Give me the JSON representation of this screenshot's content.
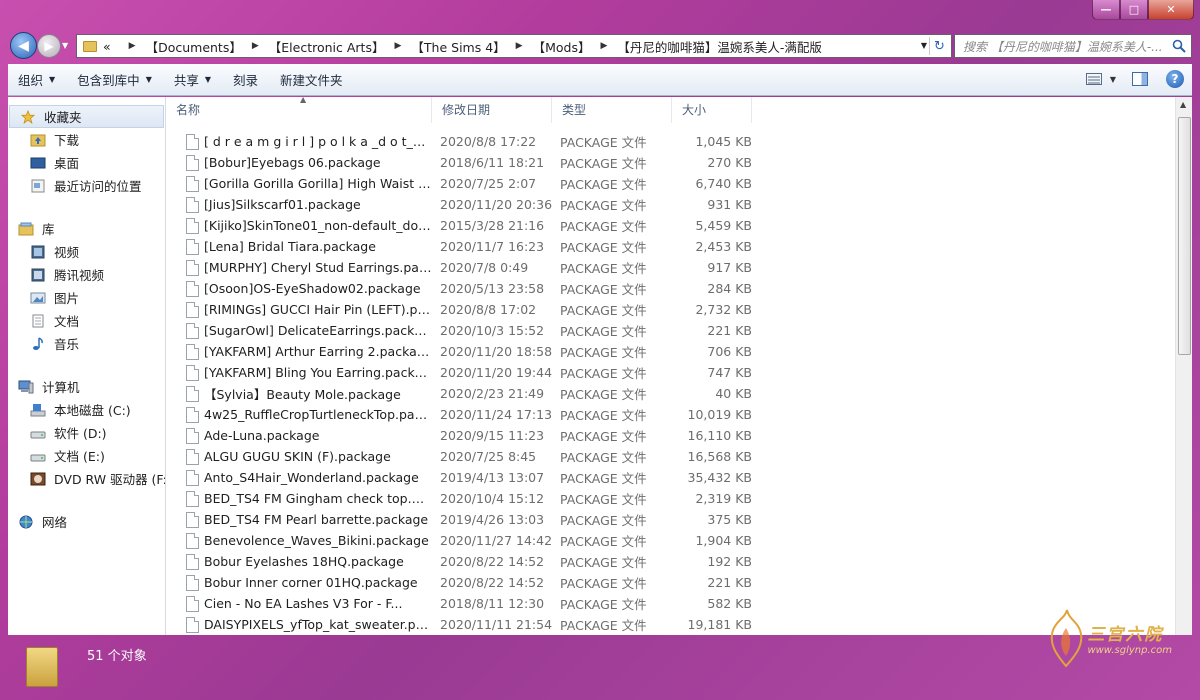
{
  "window": {
    "min_glyph": "—",
    "max_glyph": "□",
    "close_glyph": "✕"
  },
  "address": {
    "back_glyph": "◀",
    "forward_glyph": "▶",
    "overflow": "«",
    "crumbs": [
      "【Documents】",
      "【Electronic Arts】",
      "【The Sims 4】",
      "【Mods】",
      "【丹尼的咖啡猫】温婉系美人-满配版"
    ],
    "separator": "▶",
    "refresh_glyph": "↻"
  },
  "search": {
    "placeholder": "搜索 【丹尼的咖啡猫】温婉系美人-..."
  },
  "toolbar": {
    "organize": "组织",
    "include": "包含到库中",
    "share": "共享",
    "burn": "刻录",
    "new_folder": "新建文件夹",
    "arrow": "▼",
    "help": "?"
  },
  "nav": {
    "favorites": {
      "label": "收藏夹",
      "items": [
        "下载",
        "桌面",
        "最近访问的位置"
      ]
    },
    "libraries": {
      "label": "库",
      "items": [
        "视频",
        "腾讯视频",
        "图片",
        "文档",
        "音乐"
      ]
    },
    "computer": {
      "label": "计算机",
      "items": [
        "本地磁盘 (C:)",
        "软件 (D:)",
        "文档 (E:)",
        "DVD RW 驱动器 (F:"
      ]
    },
    "network": {
      "label": "网络"
    }
  },
  "columns": {
    "name": "名称",
    "date": "修改日期",
    "type": "类型",
    "size": "大小"
  },
  "files": [
    {
      "name": "[ d r e a m g i r l ] p o l k a _d o t_p e...",
      "date": "2020/8/8 17:22",
      "type": "PACKAGE 文件",
      "size": "1,045 KB"
    },
    {
      "name": "[Bobur]Eyebags 06.package",
      "date": "2018/6/11 18:21",
      "type": "PACKAGE 文件",
      "size": "270 KB"
    },
    {
      "name": "[Gorilla Gorilla Gorilla] High Waist Fri...",
      "date": "2020/7/25 2:07",
      "type": "PACKAGE 文件",
      "size": "6,740 KB"
    },
    {
      "name": "[Jius]Silkscarf01.package",
      "date": "2020/11/20 20:36",
      "type": "PACKAGE 文件",
      "size": "931 KB"
    },
    {
      "name": "[Kijiko]SkinTone01_non-default_dolly....",
      "date": "2015/3/28 21:16",
      "type": "PACKAGE 文件",
      "size": "5,459 KB"
    },
    {
      "name": "[Lena] Bridal Tiara.package",
      "date": "2020/11/7 16:23",
      "type": "PACKAGE 文件",
      "size": "2,453 KB"
    },
    {
      "name": "[MURPHY] Cheryl Stud Earrings.pack...",
      "date": "2020/7/8 0:49",
      "type": "PACKAGE 文件",
      "size": "917 KB"
    },
    {
      "name": "[Osoon]OS-EyeShadow02.package",
      "date": "2020/5/13 23:58",
      "type": "PACKAGE 文件",
      "size": "284 KB"
    },
    {
      "name": "[RIMINGs] GUCCI Hair Pin (LEFT).pac...",
      "date": "2020/8/8 17:02",
      "type": "PACKAGE 文件",
      "size": "2,732 KB"
    },
    {
      "name": "[SugarOwl] DelicateEarrings.package",
      "date": "2020/10/3 15:52",
      "type": "PACKAGE 文件",
      "size": "221 KB"
    },
    {
      "name": "[YAKFARM] Arthur Earring 2.package",
      "date": "2020/11/20 18:58",
      "type": "PACKAGE 文件",
      "size": "706 KB"
    },
    {
      "name": "[YAKFARM] Bling You Earring.package",
      "date": "2020/11/20 19:44",
      "type": "PACKAGE 文件",
      "size": "747 KB"
    },
    {
      "name": "【Sylvia】Beauty Mole.package",
      "date": "2020/2/23 21:49",
      "type": "PACKAGE 文件",
      "size": "40 KB"
    },
    {
      "name": "4w25_RuffleCropTurtleneckTop.pack...",
      "date": "2020/11/24 17:13",
      "type": "PACKAGE 文件",
      "size": "10,019 KB"
    },
    {
      "name": "Ade-Luna.package",
      "date": "2020/9/15 11:23",
      "type": "PACKAGE 文件",
      "size": "16,110 KB"
    },
    {
      "name": "ALGU GUGU SKIN (F).package",
      "date": "2020/7/25 8:45",
      "type": "PACKAGE 文件",
      "size": "16,568 KB"
    },
    {
      "name": "Anto_S4Hair_Wonderland.package",
      "date": "2019/4/13 13:07",
      "type": "PACKAGE 文件",
      "size": "35,432 KB"
    },
    {
      "name": "BED_TS4 FM Gingham check top.pac...",
      "date": "2020/10/4 15:12",
      "type": "PACKAGE 文件",
      "size": "2,319 KB"
    },
    {
      "name": "BED_TS4 FM Pearl barrette.package",
      "date": "2019/4/26 13:03",
      "type": "PACKAGE 文件",
      "size": "375 KB"
    },
    {
      "name": "Benevolence_Waves_Bikini.package",
      "date": "2020/11/27 14:42",
      "type": "PACKAGE 文件",
      "size": "1,904 KB"
    },
    {
      "name": "Bobur Eyelashes 18HQ.package",
      "date": "2020/8/22 14:52",
      "type": "PACKAGE 文件",
      "size": "192 KB"
    },
    {
      "name": "Bobur Inner corner 01HQ.package",
      "date": "2020/8/22 14:52",
      "type": "PACKAGE 文件",
      "size": "221 KB"
    },
    {
      "name": "Cien  -  No EA Lashes V3  For  -  F...",
      "date": "2018/8/11 12:30",
      "type": "PACKAGE 文件",
      "size": "582 KB"
    },
    {
      "name": "DAISYPIXELS_yfTop_kat_sweater.pack...",
      "date": "2020/11/11 21:54",
      "type": "PACKAGE 文件",
      "size": "19,181 KB"
    }
  ],
  "status": {
    "count": "51 个对象"
  },
  "watermark": {
    "title": "三宫六院",
    "url": "www.sglynp.com"
  }
}
